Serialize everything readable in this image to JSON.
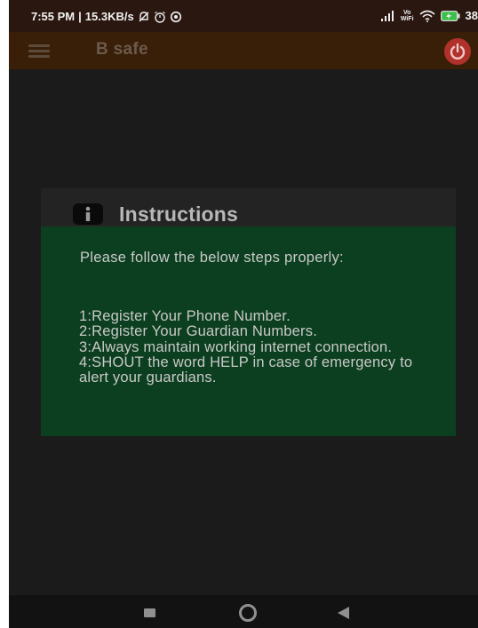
{
  "status_bar": {
    "time": "7:55 PM",
    "separator": "|",
    "net_speed": "15.3KB/s",
    "vowifi_top": "Vo",
    "vowifi_bottom": "WiFi",
    "battery": "38"
  },
  "app_bar": {
    "title": "B safe",
    "menu_icon": "hamburger-menu-icon",
    "power_icon": "power-icon"
  },
  "dialog": {
    "icon": "info-icon",
    "title": "Instructions",
    "intro": "Please follow the below steps properly:",
    "steps": "  1:Register Your Phone Number.\n  2:Register Your Guardian Numbers.\n  3:Always maintain working internet connection.\n  4:SHOUT the word HELP in case of emergency to alert your guardians."
  },
  "nav_bar": {
    "recent_icon": "recent-apps-icon",
    "home_icon": "home-icon",
    "back_icon": "back-icon"
  },
  "colors": {
    "status_bar_bg": "#2a1710",
    "app_bar_bg": "#3a1f08",
    "dialog_header_bg": "#232323",
    "dialog_body_bg": "#0c3f1f",
    "power_button": "#b0302a",
    "screen_bg": "#1b1b1b"
  }
}
